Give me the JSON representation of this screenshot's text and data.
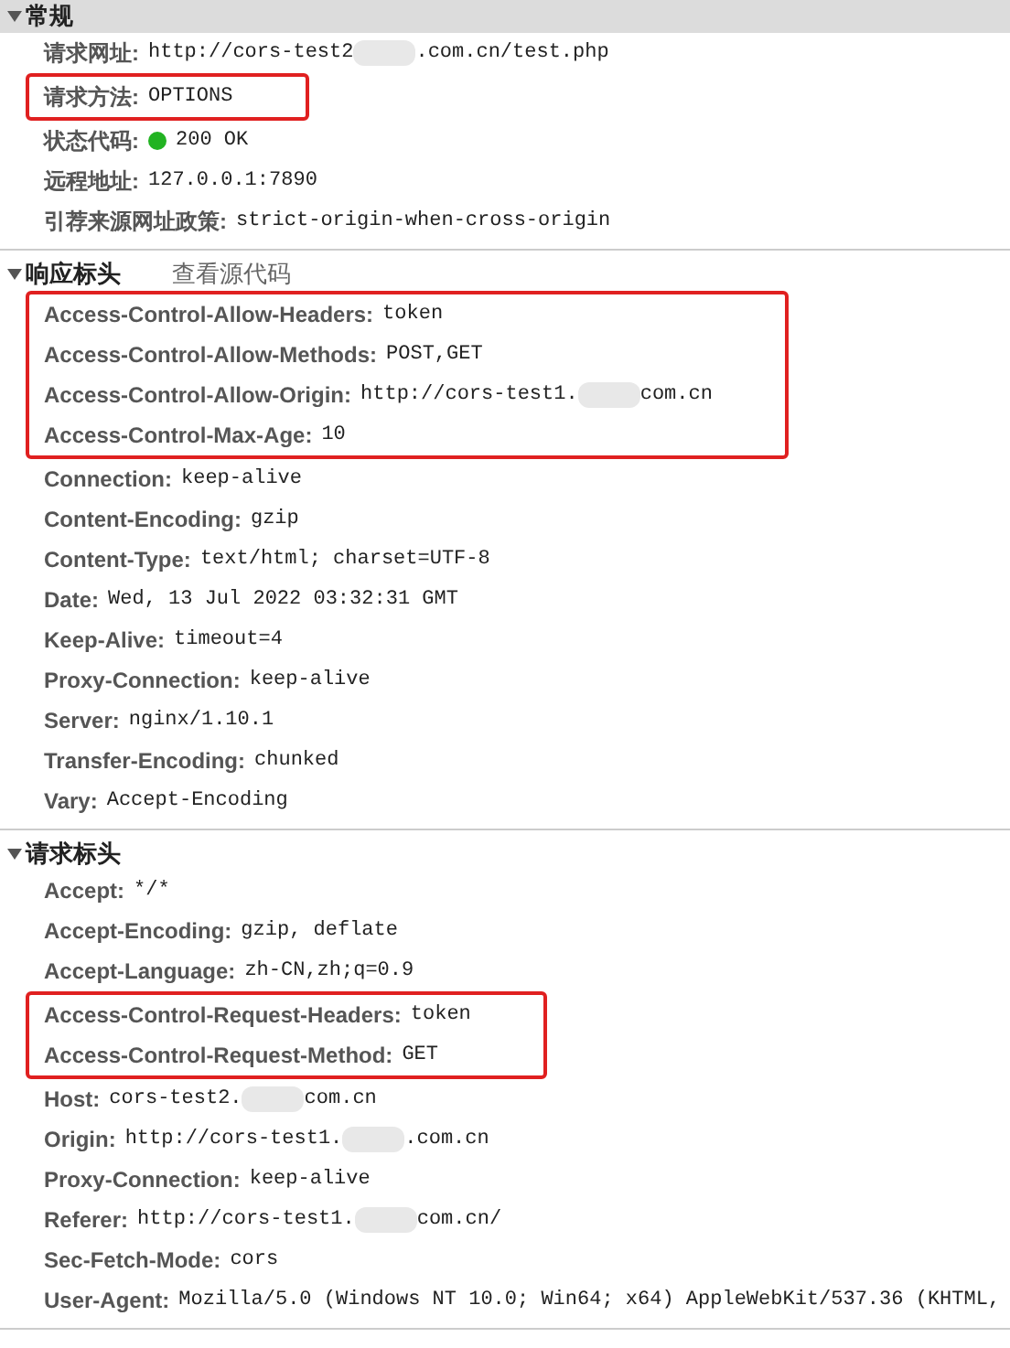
{
  "sections": [
    {
      "title": "常规",
      "expanded": true,
      "shaded": true,
      "rows": [
        {
          "name": "请求网址:",
          "value": "http://cors-test2",
          "value_after": ".com.cn/test.php",
          "highlighted": false
        },
        {
          "name": "请求方法:",
          "value": "OPTIONS",
          "highlighted": true
        },
        {
          "name": "状态代码:",
          "value": "200 OK",
          "color": "#22b322",
          "highlighted": false
        },
        {
          "name": "远程地址:",
          "value": "127.0.0.1:7890",
          "highlighted": false
        },
        {
          "name": "引荐来源网址政策:",
          "value": "strict-origin-when-cross-origin",
          "highlighted": false
        }
      ]
    },
    {
      "title": "响应标头",
      "expanded": true,
      "shaded": false,
      "link": "查看源代码",
      "rows": [
        {
          "name": "Access-Control-Allow-Headers:",
          "value": "token",
          "highlighted": true
        },
        {
          "name": "Access-Control-Allow-Methods:",
          "value": "POST,GET",
          "highlighted": true
        },
        {
          "name": "Access-Control-Allow-Origin:",
          "value": "http://cors-test1.",
          "value_after": "com.cn",
          "highlighted": true
        },
        {
          "name": "Access-Control-Max-Age:",
          "value": "10",
          "highlighted": true
        },
        {
          "name": "Connection:",
          "value": "keep-alive",
          "highlighted": false
        },
        {
          "name": "Content-Encoding:",
          "value": "gzip",
          "highlighted": false
        },
        {
          "name": "Content-Type:",
          "value": "text/html; charset=UTF-8",
          "highlighted": false
        },
        {
          "name": "Date:",
          "value": "Wed, 13 Jul 2022 03:32:31 GMT",
          "highlighted": false
        },
        {
          "name": "Keep-Alive:",
          "value": "timeout=4",
          "highlighted": false
        },
        {
          "name": "Proxy-Connection:",
          "value": "keep-alive",
          "highlighted": false
        },
        {
          "name": "Server:",
          "value": "nginx/1.10.1",
          "highlighted": false
        },
        {
          "name": "Transfer-Encoding:",
          "value": "chunked",
          "highlighted": false
        },
        {
          "name": "Vary:",
          "value": "Accept-Encoding",
          "highlighted": false
        }
      ]
    },
    {
      "title": "请求标头",
      "expanded": true,
      "shaded": false,
      "rows": [
        {
          "name": "Accept:",
          "value": "*/*",
          "highlighted": false
        },
        {
          "name": "Accept-Encoding:",
          "value": "gzip, deflate",
          "highlighted": false
        },
        {
          "name": "Accept-Language:",
          "value": "zh-CN,zh;q=0.9",
          "highlighted": false
        },
        {
          "name": "Access-Control-Request-Headers:",
          "value": "token",
          "highlighted": true
        },
        {
          "name": "Access-Control-Request-Method:",
          "value": "GET",
          "highlighted": true
        },
        {
          "name": "Host:",
          "value": "cors-test2.",
          "value_after": "com.cn",
          "highlighted": false
        },
        {
          "name": "Origin:",
          "value": "http://cors-test1.",
          "value_after": ".com.cn",
          "highlighted": false
        },
        {
          "name": "Proxy-Connection:",
          "value": "keep-alive",
          "highlighted": false
        },
        {
          "name": "Referer:",
          "value": "http://cors-test1.",
          "value_after": "com.cn/",
          "highlighted": false
        },
        {
          "name": "Sec-Fetch-Mode:",
          "value": "cors",
          "highlighted": false
        },
        {
          "name": "User-Agent:",
          "value": "Mozilla/5.0 (Windows NT 10.0; Win64; x64) AppleWebKit/537.36 (KHTML,",
          "highlighted": false
        }
      ]
    }
  ]
}
